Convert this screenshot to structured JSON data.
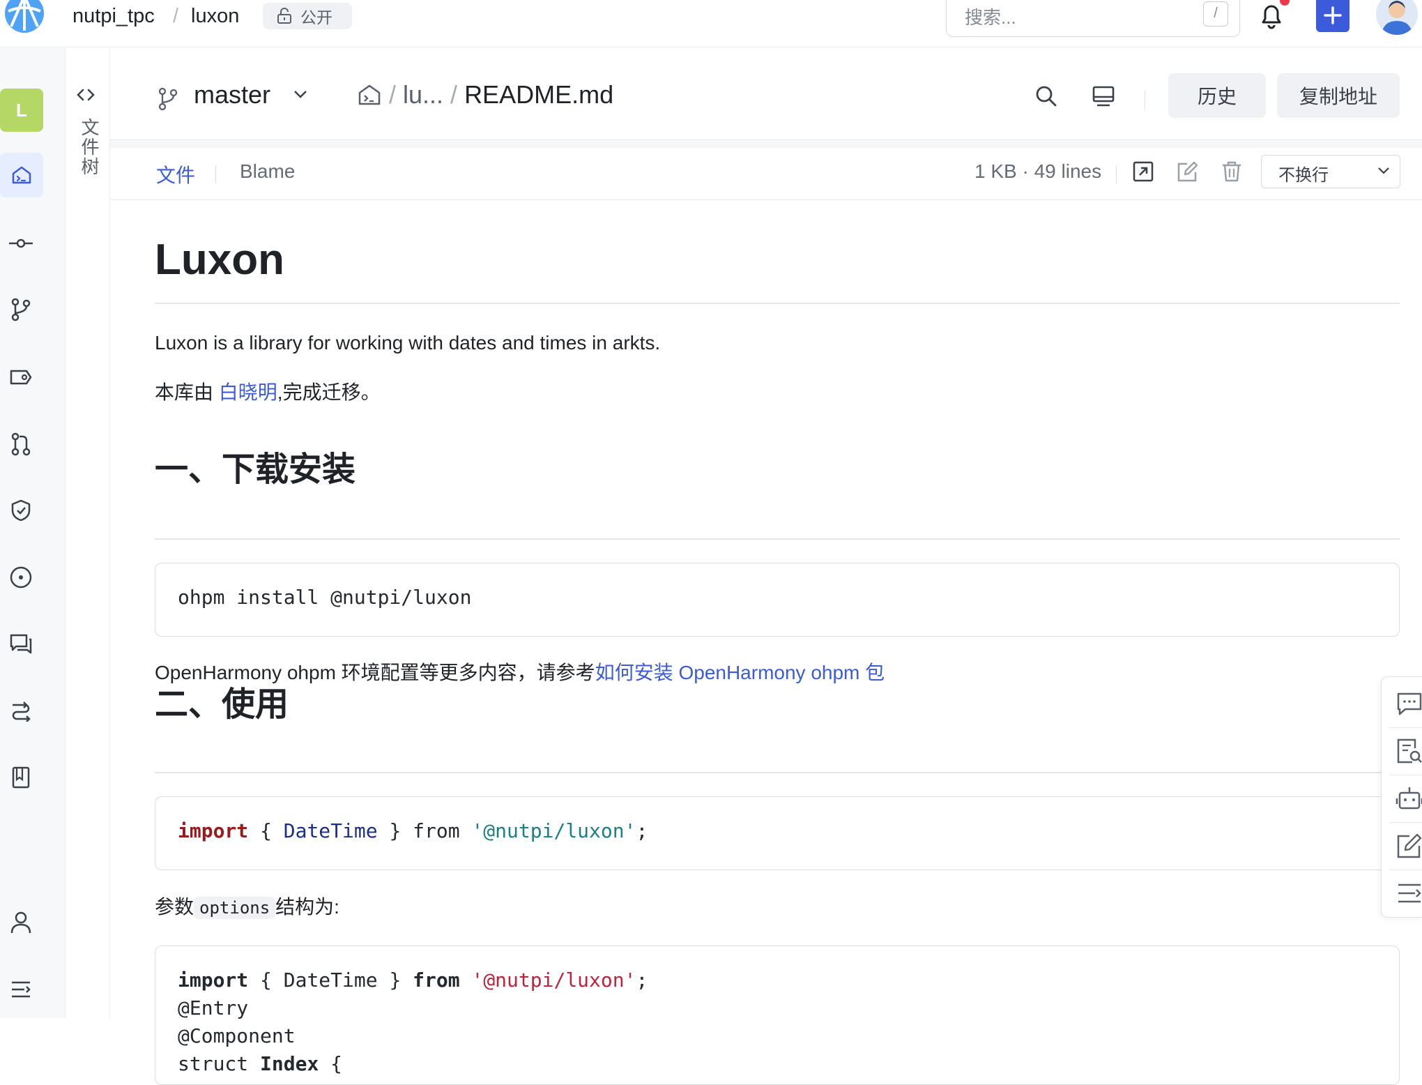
{
  "topbar": {
    "org": "nutpi_tpc",
    "repo": "luxon",
    "visibility": "公开",
    "search_placeholder": "搜索...",
    "search_shortcut": "/"
  },
  "rail": {
    "avatar_letter": "L",
    "items": [
      "code",
      "commits",
      "branches",
      "tags",
      "pull-requests",
      "security",
      "issues",
      "discussions",
      "pipelines",
      "wiki",
      "members",
      "collapse"
    ]
  },
  "file_tree": {
    "label": "文件树"
  },
  "file_header": {
    "branch": "master",
    "path_parent": "lu...",
    "file_name": "README.md",
    "history_label": "历史",
    "copy_label": "复制地址"
  },
  "tabs": {
    "file": "文件",
    "blame": "Blame",
    "meta": "1 KB · 49 lines",
    "wrap_option": "不换行"
  },
  "readme": {
    "title": "Luxon",
    "intro": "Luxon is a library for working with dates and times in arkts.",
    "credit_prefix": "本库由 ",
    "credit_link": "白晓明",
    "credit_suffix": ",完成迁移。",
    "h2_install": "一、下载安装",
    "install_cmd": "ohpm install @nutpi/luxon",
    "ohpm_text": "OpenHarmony ohpm 环境配置等更多内容，请参考",
    "ohpm_link": "如何安装 OpenHarmony ohpm 包",
    "h2_usage": "二、使用",
    "code1": {
      "import_kw": "import",
      "open": " { ",
      "symbol": "DateTime",
      "close": " } from ",
      "module": "'@nutpi/luxon'",
      "end": ";"
    },
    "options_prefix": "参数",
    "options_code": "options",
    "options_suffix": "结构为:",
    "code2": {
      "import_kw": "import",
      "mid": " { DateTime } ",
      "from_kw": "from",
      "module": "'@nutpi/luxon'",
      "end": ";",
      "line2": "@Entry",
      "line3": "@Component",
      "line4_kw": "struct ",
      "line4_name": "Index",
      "line4_end": " {"
    }
  },
  "colors": {
    "accent": "#3b5bdb",
    "rail_avatar": "#b5d766",
    "notification": "#f0384d"
  }
}
